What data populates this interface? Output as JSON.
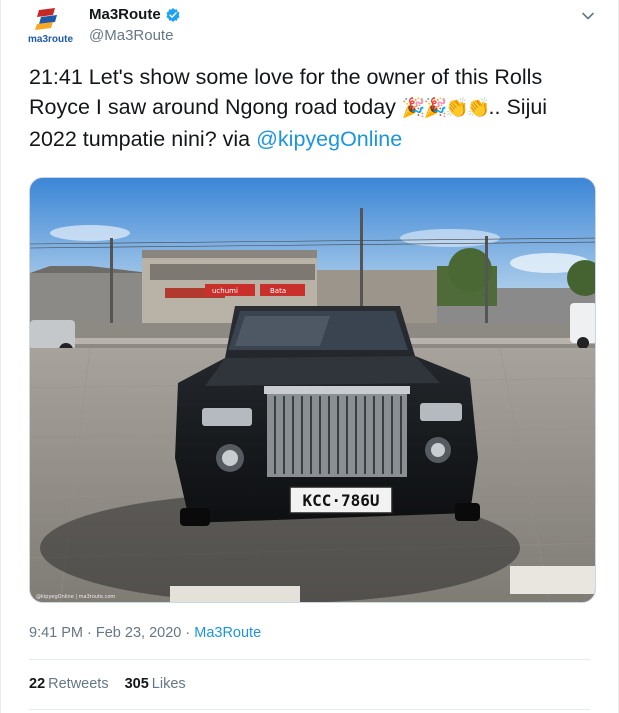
{
  "author": {
    "display_name": "Ma3Route",
    "handle": "@Ma3Route",
    "avatar_label": "ma3route",
    "verified": true
  },
  "tweet": {
    "text_part1": "21:41 Let's show some love for the owner of this Rolls Royce I saw around Ngong road today ",
    "emojis": "🎉🎉👏👏",
    "text_part2": ".. Sijui 2022 tumpatie nini?   via ",
    "mention": "@kipyegOnline"
  },
  "photo": {
    "plate": "KCC·786U",
    "watermark": "@kipyegOnline | ma3route.com",
    "shop_signs": [
      "uchumi",
      "Bata"
    ]
  },
  "meta": {
    "time": "9:41 PM",
    "separator1": " · ",
    "date": "Feb 23, 2020",
    "separator2": " · ",
    "source": "Ma3Route"
  },
  "stats": {
    "retweets_count": "22",
    "retweets_label": "Retweets",
    "likes_count": "305",
    "likes_label": "Likes"
  },
  "colors": {
    "link": "#1b95e0",
    "text": "#14171a",
    "muted": "#657786",
    "verified": "#1da1f2"
  }
}
